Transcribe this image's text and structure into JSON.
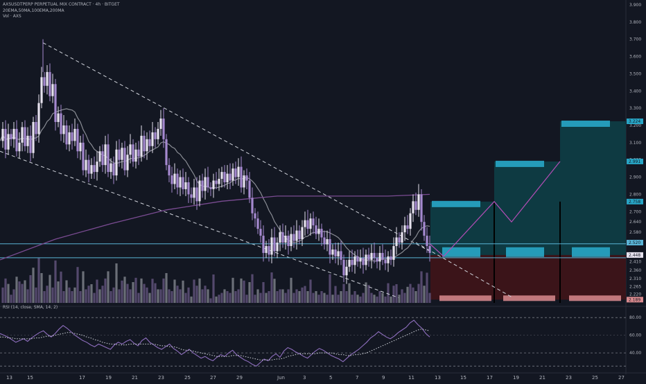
{
  "header": {
    "title": "AXSUSDTPERP PERPETUAL MIX CONTRACT · 4h · BITGET",
    "indicators": "20EMA,50MA,100EMA,200MA",
    "volume": "Vol · AXS",
    "rsi": "RSI (14, close, SMA, 14, 2)"
  },
  "colors": {
    "background": "#131722",
    "candle": "#a589cf",
    "candle_light": "#e6e2ee",
    "ma_gray": "#8a8d95",
    "ma_purple": "#7b4c93",
    "level_line": "#5ab4d6",
    "target_zone": "#0e3c44",
    "stop_zone": "#3d1419",
    "tag_blue": "#28a6c6",
    "tag_red": "#d98a8e",
    "projection": "#b34db5",
    "rsi_line": "#8f6fbf"
  },
  "chart_data": [
    {
      "type": "candlestick",
      "title": "",
      "x_ticks": [
        "13",
        "15",
        "17",
        "19",
        "21",
        "23",
        "25",
        "27",
        "29",
        "Jun",
        "3",
        "5",
        "7",
        "9",
        "11",
        "13",
        "15",
        "17",
        "19",
        "21",
        "23",
        "25",
        "27"
      ],
      "y_axis": {
        "ticks": [
          3.9,
          3.8,
          3.7,
          3.6,
          3.5,
          3.4,
          3.3,
          3.2,
          3.1,
          3.0,
          2.9,
          2.8,
          2.7,
          2.64,
          2.58,
          2.52,
          2.47,
          2.41,
          2.36,
          2.31,
          2.265,
          2.22,
          2.175
        ],
        "tick_labels": [
          "3.900",
          "3.800",
          "3.700",
          "3.600",
          "3.500",
          "3.400",
          "3.300",
          "3.200",
          "3.100",
          "3.000",
          "2.900",
          "2.800",
          "2.700",
          "2.640",
          "2.580",
          "2.520",
          "",
          "2.410",
          "2.360",
          "2.310",
          "2.265",
          "2.220",
          ""
        ],
        "range": [
          2.17,
          3.92
        ]
      },
      "price_tags": [
        {
          "label": "3.224",
          "value": 3.224,
          "color": "#28a6c6"
        },
        {
          "label": "2.991",
          "value": 2.991,
          "color": "#28a6c6"
        },
        {
          "label": "2.758",
          "value": 2.758,
          "color": "#28a6c6"
        },
        {
          "label": "2.520",
          "value": 2.52,
          "color": "#5ab4d6"
        },
        {
          "label": "2.448",
          "value": 2.448,
          "color": "#e6e2ee"
        },
        {
          "label": "2.189",
          "value": 2.189,
          "color": "#d98a8e"
        }
      ],
      "horizontal_levels": [
        2.513,
        2.432
      ],
      "price_path": [
        [
          0,
          3.11
        ],
        [
          4,
          3.18
        ],
        [
          8,
          3.06
        ],
        [
          12,
          3.15
        ],
        [
          16,
          3.12
        ],
        [
          20,
          3.18
        ],
        [
          24,
          3.05
        ],
        [
          28,
          3.1
        ],
        [
          32,
          3.19
        ],
        [
          36,
          3.08
        ],
        [
          40,
          3.14
        ],
        [
          44,
          3.04
        ],
        [
          48,
          3.22
        ],
        [
          52,
          3.15
        ],
        [
          56,
          3.33
        ],
        [
          60,
          3.48
        ],
        [
          64,
          3.43
        ],
        [
          68,
          3.51
        ],
        [
          72,
          3.37
        ],
        [
          76,
          3.44
        ],
        [
          80,
          3.22
        ],
        [
          84,
          3.27
        ],
        [
          88,
          3.15
        ],
        [
          92,
          3.2
        ],
        [
          96,
          3.09
        ],
        [
          100,
          3.16
        ],
        [
          104,
          3.11
        ],
        [
          108,
          3.18
        ],
        [
          112,
          3.05
        ],
        [
          116,
          3.1
        ],
        [
          120,
          2.94
        ],
        [
          124,
          3.0
        ],
        [
          128,
          2.92
        ],
        [
          132,
          2.97
        ],
        [
          136,
          2.93
        ],
        [
          140,
          2.99
        ],
        [
          144,
          3.05
        ],
        [
          148,
          2.97
        ],
        [
          152,
          3.09
        ],
        [
          156,
          2.93
        ],
        [
          160,
          2.98
        ],
        [
          164,
          2.91
        ],
        [
          168,
          3.06
        ],
        [
          172,
          3.0
        ],
        [
          176,
          3.07
        ],
        [
          180,
          2.94
        ],
        [
          184,
          3.03
        ],
        [
          188,
          3.09
        ],
        [
          192,
          2.99
        ],
        [
          196,
          3.06
        ],
        [
          200,
          3.02
        ],
        [
          204,
          3.14
        ],
        [
          208,
          3.05
        ],
        [
          212,
          3.12
        ],
        [
          216,
          3.08
        ],
        [
          220,
          3.16
        ],
        [
          224,
          3.12
        ],
        [
          228,
          3.18
        ],
        [
          232,
          3.24
        ],
        [
          236,
          3.12
        ],
        [
          240,
          2.97
        ],
        [
          244,
          2.91
        ],
        [
          248,
          2.86
        ],
        [
          252,
          2.92
        ],
        [
          256,
          2.84
        ],
        [
          260,
          2.9
        ],
        [
          264,
          2.83
        ],
        [
          268,
          2.87
        ],
        [
          272,
          2.8
        ],
        [
          276,
          2.78
        ],
        [
          280,
          2.84
        ],
        [
          284,
          2.76
        ],
        [
          288,
          2.88
        ],
        [
          292,
          2.82
        ],
        [
          296,
          2.9
        ],
        [
          300,
          2.84
        ],
        [
          304,
          2.83
        ],
        [
          308,
          2.88
        ],
        [
          312,
          2.86
        ],
        [
          316,
          2.89
        ],
        [
          320,
          2.93
        ],
        [
          324,
          2.87
        ],
        [
          328,
          2.92
        ],
        [
          332,
          2.88
        ],
        [
          336,
          2.95
        ],
        [
          340,
          2.9
        ],
        [
          344,
          2.96
        ],
        [
          348,
          2.84
        ],
        [
          352,
          2.91
        ],
        [
          356,
          2.88
        ],
        [
          360,
          2.78
        ],
        [
          364,
          2.69
        ],
        [
          368,
          2.66
        ],
        [
          372,
          2.6
        ],
        [
          376,
          2.56
        ],
        [
          380,
          2.46
        ],
        [
          384,
          2.5
        ],
        [
          388,
          2.45
        ],
        [
          392,
          2.55
        ],
        [
          396,
          2.47
        ],
        [
          400,
          2.52
        ],
        [
          404,
          2.58
        ],
        [
          408,
          2.52
        ],
        [
          412,
          2.56
        ],
        [
          416,
          2.5
        ],
        [
          420,
          2.57
        ],
        [
          424,
          2.53
        ],
        [
          428,
          2.59
        ],
        [
          432,
          2.54
        ],
        [
          436,
          2.61
        ],
        [
          440,
          2.65
        ],
        [
          444,
          2.6
        ],
        [
          448,
          2.66
        ],
        [
          452,
          2.62
        ],
        [
          456,
          2.57
        ],
        [
          460,
          2.6
        ],
        [
          464,
          2.55
        ],
        [
          468,
          2.51
        ],
        [
          472,
          2.54
        ],
        [
          476,
          2.45
        ],
        [
          480,
          2.48
        ],
        [
          484,
          2.44
        ],
        [
          488,
          2.47
        ],
        [
          492,
          2.42
        ],
        [
          496,
          2.33
        ],
        [
          500,
          2.38
        ],
        [
          504,
          2.42
        ],
        [
          508,
          2.39
        ],
        [
          512,
          2.44
        ],
        [
          516,
          2.41
        ],
        [
          520,
          2.43
        ],
        [
          524,
          2.39
        ],
        [
          528,
          2.45
        ],
        [
          532,
          2.42
        ],
        [
          536,
          2.46
        ],
        [
          540,
          2.43
        ],
        [
          544,
          2.41
        ],
        [
          548,
          2.46
        ],
        [
          552,
          2.42
        ],
        [
          556,
          2.4
        ],
        [
          560,
          2.44
        ],
        [
          564,
          2.42
        ],
        [
          568,
          2.5
        ],
        [
          572,
          2.55
        ],
        [
          576,
          2.52
        ],
        [
          580,
          2.58
        ],
        [
          584,
          2.62
        ],
        [
          588,
          2.6
        ],
        [
          592,
          2.69
        ],
        [
          596,
          2.76
        ],
        [
          600,
          2.71
        ],
        [
          604,
          2.8
        ],
        [
          608,
          2.64
        ],
        [
          612,
          2.56
        ],
        [
          616,
          2.5
        ],
        [
          620,
          2.46
        ]
      ]
    },
    {
      "type": "line",
      "title": "",
      "series": [
        {
          "name": "RSI",
          "values": [
            62,
            60,
            58,
            55,
            52,
            54,
            56,
            53,
            57,
            60,
            63,
            65,
            61,
            58,
            62,
            67,
            71,
            68,
            64,
            60,
            57,
            54,
            52,
            49,
            47,
            50,
            48,
            46,
            44,
            49,
            52,
            50,
            53,
            55,
            51,
            48,
            54,
            57,
            52,
            49,
            46,
            44,
            47,
            50,
            45,
            42,
            38,
            41,
            44,
            40,
            37,
            34,
            36,
            33,
            31,
            35,
            38,
            36,
            40,
            43,
            38,
            35,
            32,
            30,
            27,
            25,
            29,
            33,
            31,
            36,
            39,
            35,
            42,
            46,
            44,
            41,
            39,
            36,
            34,
            38,
            42,
            45,
            43,
            40,
            37,
            35,
            33,
            30,
            34,
            38,
            41,
            44,
            48,
            52,
            57,
            60,
            64,
            61,
            58,
            56,
            59,
            63,
            66,
            69,
            74,
            77,
            72,
            68,
            62,
            58
          ]
        },
        {
          "name": "SMA",
          "values": [
            58,
            58,
            57,
            57,
            56,
            56,
            56,
            56,
            56,
            57,
            57,
            58,
            59,
            59,
            60,
            61,
            62,
            63,
            63,
            62,
            61,
            60,
            58,
            57,
            55,
            54,
            52,
            51,
            50,
            50,
            49,
            49,
            49,
            50,
            50,
            50,
            50,
            50,
            50,
            50,
            49,
            48,
            48,
            47,
            47,
            46,
            44,
            43,
            43,
            42,
            41,
            40,
            39,
            38,
            37,
            36,
            36,
            36,
            36,
            37,
            37,
            37,
            36,
            35,
            34,
            33,
            32,
            32,
            32,
            32,
            33,
            33,
            34,
            36,
            37,
            38,
            39,
            39,
            39,
            39,
            39,
            40,
            40,
            40,
            40,
            39,
            38,
            38,
            37,
            37,
            38,
            38,
            39,
            40,
            42,
            44,
            46,
            48,
            50,
            52,
            54,
            56,
            58,
            60,
            62,
            64,
            66,
            67,
            66,
            65
          ]
        }
      ],
      "y_axis": {
        "ticks": [
          80,
          60,
          40
        ],
        "tick_labels": [
          "80.00",
          "60.00",
          "40.00"
        ],
        "range": [
          22,
          88
        ]
      }
    }
  ]
}
